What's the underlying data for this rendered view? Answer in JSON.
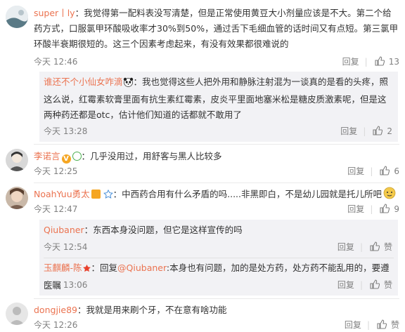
{
  "comments": [
    {
      "user": "super丨ly",
      "text": "：我觉得第一配料表没写清楚，但是正常使用黄豆大小剂量应该是不大。第二个给药方式，口服氯甲环酸吸收率才30%到50%，通过舌下毛细血管的话时间又有点短。第三氯甲环酸半衰期很短的。这三个因素考虑起来，有没有效果都很难说的",
      "time": "今天 12:46",
      "reply_label": "回复",
      "likes": "13",
      "replies": [
        {
          "user": "谁还不个小仙女咋滴",
          "text": "：我也觉得这些人把外用和静脉注射混为一谈真的是看的头疼，照这么说，红霉素软膏里面有抗生素红霉素，皮炎平里面地塞米松是糖皮质激素呢，但是这两种药还都是otc，估计他们知道的话都就不敢用了",
          "time": "今天 13:28",
          "reply_label": "回复",
          "likes": "2"
        }
      ]
    },
    {
      "user": "李诺言",
      "text": "：几乎没用过，用舒客与黑人比较多",
      "time": "今天 12:25",
      "reply_label": "回复",
      "likes": "6"
    },
    {
      "user": "NoahYuu勇太",
      "text": "：中西药合用有什么矛盾的吗.....非黑即白，不是幼儿园就是托儿所吧",
      "time": "今天 12:47",
      "reply_label": "回复",
      "likes": "9",
      "replies": [
        {
          "user": "Qiubaner",
          "text": "：东西本身没问题，但它是这样宣传的吗",
          "time": "今天 12:54",
          "reply_label": "回复",
          "likes": "赞"
        },
        {
          "user": "玉麒麟-陈",
          "text_prefix": "：回复",
          "mention": "@Qiubaner",
          "text": ":本身也有问题，加的是处方药，处方药不能乱用的，要遵医嘱",
          "time": "今天 13:06",
          "reply_label": "回复",
          "likes": "赞"
        }
      ]
    },
    {
      "user": "dongjie89",
      "text": "：我就是用来刷个牙，不在意有啥功能",
      "time": "今天 12:26",
      "reply_label": "回复",
      "likes": "赞"
    }
  ],
  "colors": {
    "username": "#eb7350",
    "meta": "#808080",
    "subbg": "#f2f2f5"
  },
  "icons": {
    "like": "thumbs-up-icon",
    "v_badge": "verified-v-icon",
    "member": "member-crown-icon"
  }
}
